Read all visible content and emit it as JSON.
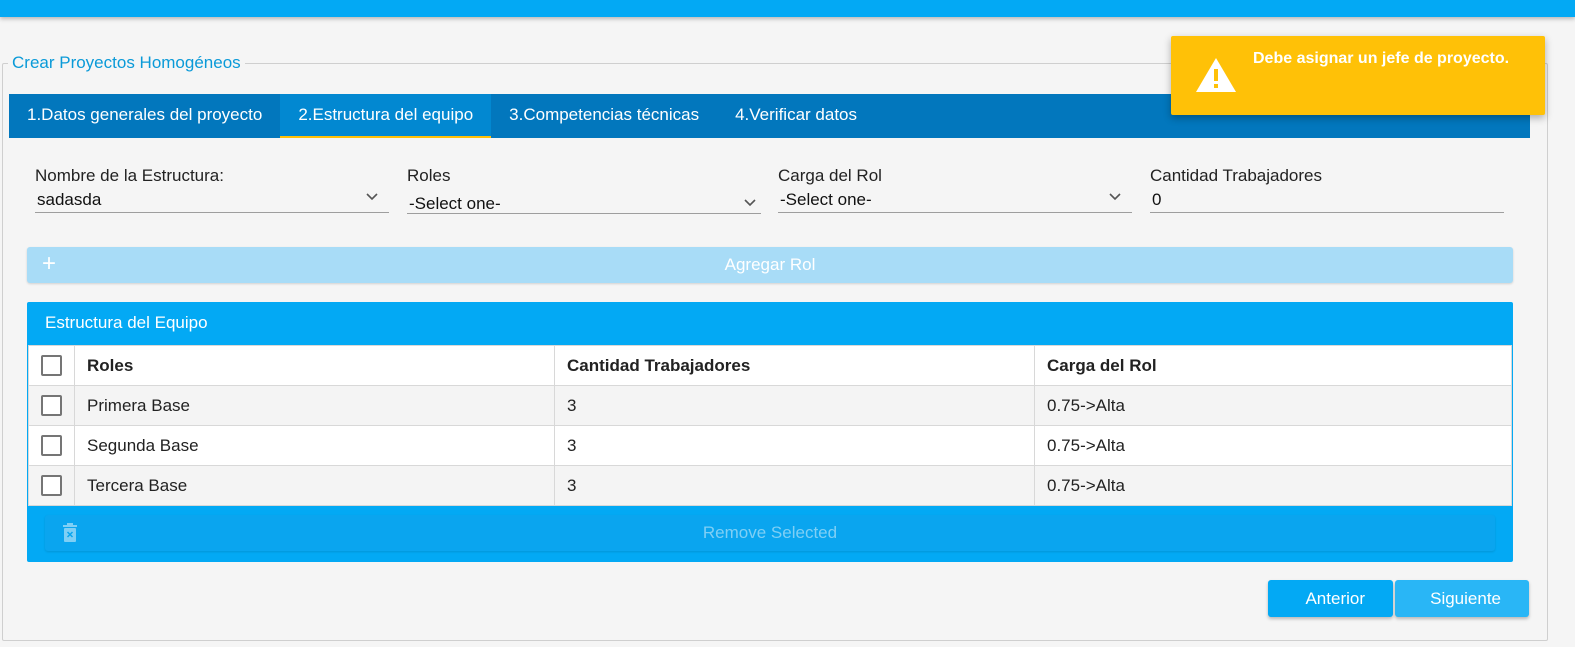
{
  "legend": "Crear Proyectos Homogéneos",
  "tabs": [
    {
      "label": "1.Datos generales del proyecto"
    },
    {
      "label": "2.Estructura del equipo"
    },
    {
      "label": "3.Competencias técnicas"
    },
    {
      "label": "4.Verificar datos"
    }
  ],
  "form": {
    "estructura": {
      "label": "Nombre de la Estructura:",
      "value": "sadasda"
    },
    "roles": {
      "label": "Roles",
      "value": "-Select one-"
    },
    "carga": {
      "label": "Carga del Rol",
      "value": "-Select one-"
    },
    "cantidad": {
      "label": "Cantidad Trabajadores",
      "value": "0"
    }
  },
  "add_button": {
    "label": "Agregar Rol",
    "icon": "plus-icon"
  },
  "panel": {
    "title": "Estructura del Equipo",
    "columns": [
      "Roles",
      "Cantidad Trabajadores",
      "Carga del Rol"
    ],
    "rows": [
      {
        "rol": "Primera Base",
        "cantidad": "3",
        "carga": "0.75->Alta"
      },
      {
        "rol": "Segunda Base",
        "cantidad": "3",
        "carga": "0.75->Alta"
      },
      {
        "rol": "Tercera Base",
        "cantidad": "3",
        "carga": "0.75->Alta"
      }
    ],
    "remove_label": "Remove Selected"
  },
  "nav": {
    "prev": "Anterior",
    "next": "Siguiente"
  },
  "toast": {
    "message": "Debe asignar un jefe de proyecto.",
    "icon": "warning-icon"
  },
  "colors": {
    "primary": "#03a9f4",
    "tab_bar": "#0277bd",
    "warning": "#ffc107"
  }
}
